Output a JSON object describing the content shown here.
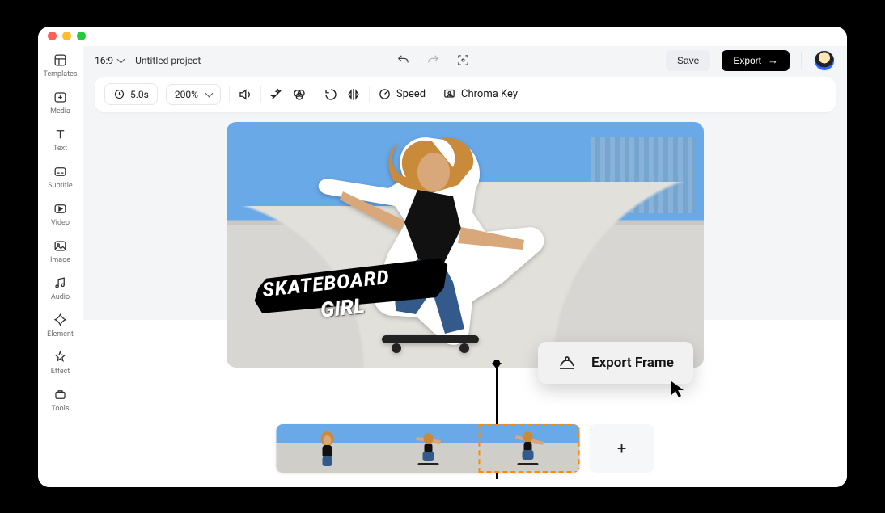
{
  "window": {
    "aspect": "16:9",
    "project_title": "Untitled project"
  },
  "header": {
    "save_label": "Save",
    "export_label": "Export"
  },
  "sidebar": {
    "items": [
      {
        "label": "Templates"
      },
      {
        "label": "Media"
      },
      {
        "label": "Text"
      },
      {
        "label": "Subtitle"
      },
      {
        "label": "Video"
      },
      {
        "label": "Image"
      },
      {
        "label": "Audio"
      },
      {
        "label": "Element"
      },
      {
        "label": "Effect"
      },
      {
        "label": "Tools"
      }
    ]
  },
  "toolbar": {
    "duration": "5.0s",
    "zoom": "200%",
    "speed_label": "Speed",
    "chroma_label": "Chroma Key"
  },
  "canvas": {
    "overlay_line1": "SKATEBOARD",
    "overlay_line2": "GIRL"
  },
  "context_menu": {
    "export_frame_label": "Export Frame"
  },
  "timeline": {
    "clips": [
      {
        "selected": false
      },
      {
        "selected": false
      },
      {
        "selected": true
      }
    ],
    "add_label": "+"
  }
}
